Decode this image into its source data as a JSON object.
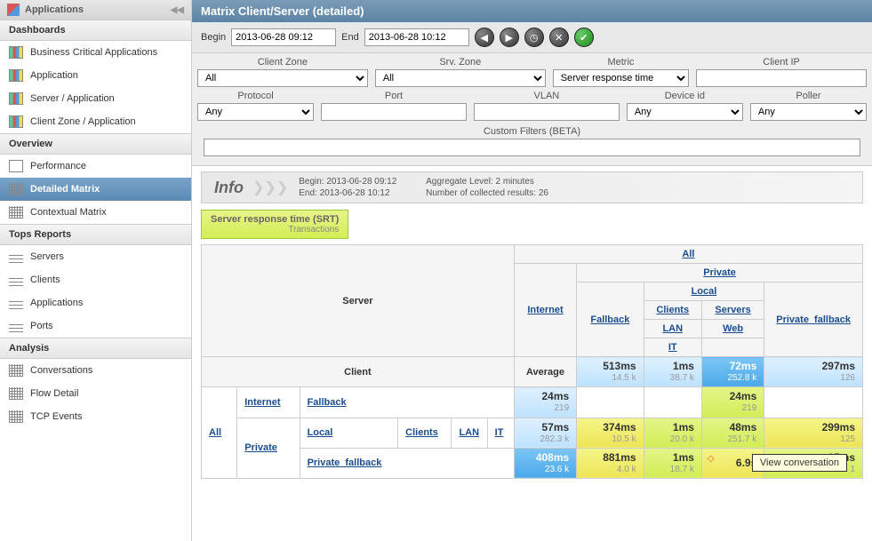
{
  "sidebar": {
    "title": "Applications",
    "sections": {
      "dashboards": {
        "title": "Dashboards",
        "items": [
          "Business Critical Applications",
          "Application",
          "Server / Application",
          "Client Zone / Application"
        ]
      },
      "overview": {
        "title": "Overview",
        "items": [
          "Performance",
          "Detailed Matrix",
          "Contextual Matrix"
        ]
      },
      "tops": {
        "title": "Tops Reports",
        "items": [
          "Servers",
          "Clients",
          "Applications",
          "Ports"
        ]
      },
      "analysis": {
        "title": "Analysis",
        "items": [
          "Conversations",
          "Flow Detail",
          "TCP Events"
        ]
      }
    }
  },
  "page": {
    "title": "Matrix Client/Server (detailed)"
  },
  "time": {
    "begin_label": "Begin",
    "begin": "2013-06-28 09:12",
    "end_label": "End",
    "end": "2013-06-28 10:12"
  },
  "filters": {
    "client_zone": {
      "label": "Client Zone",
      "value": "All"
    },
    "srv_zone": {
      "label": "Srv. Zone",
      "value": "All"
    },
    "metric": {
      "label": "Metric",
      "value": "Server response time"
    },
    "client_ip": {
      "label": "Client IP",
      "value": ""
    },
    "protocol": {
      "label": "Protocol",
      "value": "Any"
    },
    "port": {
      "label": "Port",
      "value": ""
    },
    "vlan": {
      "label": "VLAN",
      "value": ""
    },
    "device_id": {
      "label": "Device id",
      "value": "Any"
    },
    "poller": {
      "label": "Poller",
      "value": "Any"
    },
    "custom": {
      "label": "Custom Filters (BETA)",
      "value": ""
    }
  },
  "info": {
    "label": "Info",
    "begin": "Begin: 2013-06-28 09:12",
    "end": "End: 2013-06-28 10:12",
    "agg": "Aggregate Level: 2 minutes",
    "count": "Number of collected results: 26"
  },
  "badge": {
    "title": "Server response time (SRT)",
    "sub": "Transactions"
  },
  "matrix": {
    "server_label": "Server",
    "client_label": "Client",
    "avg_label": "Average",
    "top": {
      "all": "All",
      "internet": "Internet",
      "private": "Private",
      "fallback": "Fallback",
      "local": "Local",
      "private_fallback": "Private_fallback",
      "clients": "Clients",
      "servers": "Servers",
      "lan": "LAN",
      "web": "Web",
      "it": "IT"
    },
    "left": {
      "all": "All",
      "internet": "Internet",
      "fallback": "Fallback",
      "private": "Private",
      "local": "Local",
      "clients": "Clients",
      "lan": "LAN",
      "it": "IT",
      "private_fallback": "Private_fallback"
    },
    "rows": [
      {
        "avg": {
          "v": "",
          "c": ""
        },
        "c1": {
          "v": "513ms",
          "c": "14.5 k",
          "cls": "bg-blue-light"
        },
        "c2": {
          "v": "1ms",
          "c": "38.7 k",
          "cls": "bg-blue-light"
        },
        "c3": {
          "v": "72ms",
          "c": "252.8 k",
          "cls": "bg-blue"
        },
        "c4": {
          "v": "297ms",
          "c": "126",
          "cls": "bg-blue-light"
        }
      },
      {
        "avg": {
          "v": "24ms",
          "c": "219",
          "cls": "bg-blue-light"
        },
        "c1": {
          "v": "",
          "c": "",
          "cls": "bg-white"
        },
        "c2": {
          "v": "",
          "c": "",
          "cls": "bg-white"
        },
        "c3": {
          "v": "24ms",
          "c": "219",
          "cls": "bg-yellow-green"
        },
        "c4": {
          "v": "",
          "c": "",
          "cls": "bg-white"
        }
      },
      {
        "avg": {
          "v": "57ms",
          "c": "282.3 k",
          "cls": "bg-blue-light"
        },
        "c1": {
          "v": "374ms",
          "c": "10.5 k",
          "cls": "bg-yellow"
        },
        "c2": {
          "v": "1ms",
          "c": "20.0 k",
          "cls": "bg-yellow-green"
        },
        "c3": {
          "v": "48ms",
          "c": "251.7 k",
          "cls": "bg-yellow-green"
        },
        "c4": {
          "v": "299ms",
          "c": "125",
          "cls": "bg-yellow"
        }
      },
      {
        "avg": {
          "v": "408ms",
          "c": "23.6 k",
          "cls": "bg-blue"
        },
        "c1": {
          "v": "881ms",
          "c": "4.0 k",
          "cls": "bg-yellow"
        },
        "c2": {
          "v": "1ms",
          "c": "18.7 k",
          "cls": "bg-yellow-green"
        },
        "c3": {
          "v": "6.9s",
          "c": "",
          "cls": "bg-yellow hot"
        },
        "c4": {
          "v": "15ms",
          "c": "1",
          "cls": "bg-yellow-green"
        }
      }
    ]
  },
  "tooltip": "View conversation"
}
